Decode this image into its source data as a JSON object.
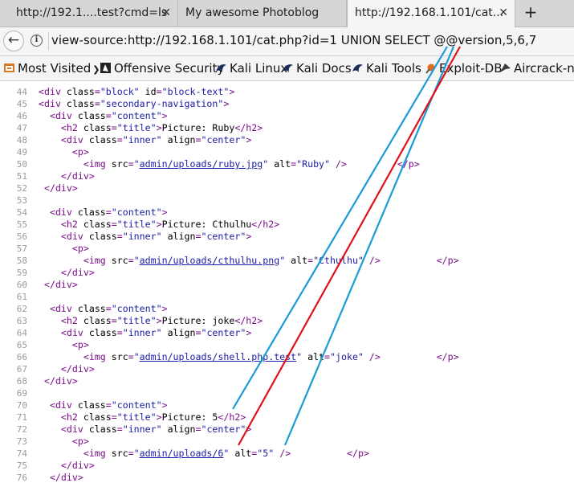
{
  "tabs": [
    {
      "title": "http://192.1....test?cmd=ls"
    },
    {
      "title": "My awesome Photoblog"
    },
    {
      "title": "http://192.168.1.101/cat..."
    }
  ],
  "nav": {
    "url": "view-source:http://192.168.1.101/cat.php?id=1 UNION SELECT @@version,5,6,7"
  },
  "bookmarks": [
    "Most Visited",
    "Offensive Security",
    "Kali Linux",
    "Kali Docs",
    "Kali Tools",
    "Exploit-DB",
    "Aircrack-ng"
  ],
  "source": {
    "lines": [
      {
        "n": "44",
        "t": "open",
        "indent": 0,
        "tag": "div",
        "attrs": [
          [
            "class",
            "block"
          ],
          [
            "id",
            "block-text"
          ]
        ]
      },
      {
        "n": "45",
        "t": "open",
        "indent": 0,
        "tag": "div",
        "attrs": [
          [
            "class",
            "secondary-navigation"
          ]
        ]
      },
      {
        "n": "46",
        "t": "open",
        "indent": 2,
        "tag": "div",
        "attrs": [
          [
            "class",
            "content"
          ]
        ]
      },
      {
        "n": "47",
        "t": "h2",
        "indent": 4,
        "text": "Picture: Ruby"
      },
      {
        "n": "48",
        "t": "open",
        "indent": 4,
        "tag": "div",
        "attrs": [
          [
            "class",
            "inner"
          ],
          [
            "align",
            "center"
          ]
        ]
      },
      {
        "n": "49",
        "t": "open",
        "indent": 6,
        "tag": "p",
        "attrs": []
      },
      {
        "n": "50",
        "t": "img",
        "indent": 8,
        "src": "admin/uploads/ruby.jpg",
        "alt": "Ruby",
        "pad": "         "
      },
      {
        "n": "51",
        "t": "close",
        "indent": 4,
        "tag": "div"
      },
      {
        "n": "52",
        "t": "close",
        "indent": 1,
        "tag": "div"
      },
      {
        "n": "53",
        "t": "blank"
      },
      {
        "n": "54",
        "t": "open",
        "indent": 2,
        "tag": "div",
        "attrs": [
          [
            "class",
            "content"
          ]
        ]
      },
      {
        "n": "55",
        "t": "h2",
        "indent": 4,
        "text": "Picture: Cthulhu"
      },
      {
        "n": "56",
        "t": "open",
        "indent": 4,
        "tag": "div",
        "attrs": [
          [
            "class",
            "inner"
          ],
          [
            "align",
            "center"
          ]
        ]
      },
      {
        "n": "57",
        "t": "open",
        "indent": 6,
        "tag": "p",
        "attrs": []
      },
      {
        "n": "58",
        "t": "img",
        "indent": 8,
        "src": "admin/uploads/cthulhu.png",
        "alt": "Cthulhu",
        "pad": "          "
      },
      {
        "n": "59",
        "t": "close",
        "indent": 4,
        "tag": "div"
      },
      {
        "n": "60",
        "t": "close",
        "indent": 1,
        "tag": "div"
      },
      {
        "n": "61",
        "t": "blank"
      },
      {
        "n": "62",
        "t": "open",
        "indent": 2,
        "tag": "div",
        "attrs": [
          [
            "class",
            "content"
          ]
        ]
      },
      {
        "n": "63",
        "t": "h2",
        "indent": 4,
        "text": "Picture: joke"
      },
      {
        "n": "64",
        "t": "open",
        "indent": 4,
        "tag": "div",
        "attrs": [
          [
            "class",
            "inner"
          ],
          [
            "align",
            "center"
          ]
        ]
      },
      {
        "n": "65",
        "t": "open",
        "indent": 6,
        "tag": "p",
        "attrs": []
      },
      {
        "n": "66",
        "t": "img",
        "indent": 8,
        "src": "admin/uploads/shell.php.test",
        "alt": "joke",
        "pad": "          "
      },
      {
        "n": "67",
        "t": "close",
        "indent": 4,
        "tag": "div"
      },
      {
        "n": "68",
        "t": "close",
        "indent": 1,
        "tag": "div"
      },
      {
        "n": "69",
        "t": "blank"
      },
      {
        "n": "70",
        "t": "open",
        "indent": 2,
        "tag": "div",
        "attrs": [
          [
            "class",
            "content"
          ]
        ]
      },
      {
        "n": "71",
        "t": "h2",
        "indent": 4,
        "text": "Picture: 5"
      },
      {
        "n": "72",
        "t": "open",
        "indent": 4,
        "tag": "div",
        "attrs": [
          [
            "class",
            "inner"
          ],
          [
            "align",
            "center"
          ]
        ]
      },
      {
        "n": "73",
        "t": "open",
        "indent": 6,
        "tag": "p",
        "attrs": []
      },
      {
        "n": "74",
        "t": "img",
        "indent": 8,
        "src": "admin/uploads/6",
        "alt": "5",
        "pad": "          "
      },
      {
        "n": "75",
        "t": "close",
        "indent": 4,
        "tag": "div"
      },
      {
        "n": "76",
        "t": "close",
        "indent": 2,
        "tag": "div"
      }
    ]
  },
  "colors": {
    "annotation_blue": "#1a9bd7",
    "annotation_red": "#e0101a"
  }
}
